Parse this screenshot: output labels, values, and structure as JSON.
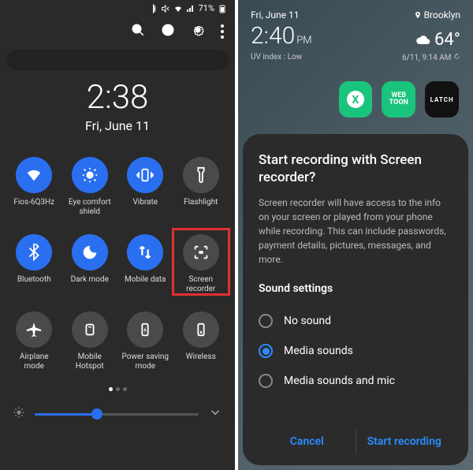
{
  "left": {
    "status": {
      "battery": "71%"
    },
    "clock": {
      "time": "2:38",
      "date": "Fri, June 11"
    },
    "tiles": [
      {
        "label": "Fios-6Q3Hz",
        "icon": "wifi",
        "on": true
      },
      {
        "label": "Eye comfort shield",
        "icon": "eye-comfort",
        "on": true
      },
      {
        "label": "Vibrate",
        "icon": "vibrate",
        "on": true
      },
      {
        "label": "Flashlight",
        "icon": "flashlight",
        "on": false
      },
      {
        "label": "Bluetooth",
        "icon": "bluetooth",
        "on": true
      },
      {
        "label": "Dark mode",
        "icon": "dark-mode",
        "on": true
      },
      {
        "label": "Mobile data",
        "icon": "mobile-data",
        "on": true
      },
      {
        "label": "Screen recorder",
        "icon": "screen-recorder",
        "on": false,
        "highlight": true
      },
      {
        "label": "Airplane mode",
        "icon": "airplane",
        "on": false
      },
      {
        "label": "Mobile Hotspot",
        "icon": "hotspot",
        "on": false
      },
      {
        "label": "Power saving mode",
        "icon": "power-saving",
        "on": false
      },
      {
        "label": "Wireless",
        "icon": "wireless",
        "on": false
      }
    ]
  },
  "right": {
    "top": {
      "date": "Fri, June 11",
      "location": "Brooklyn",
      "time": "2:40",
      "ampm": "PM",
      "temp": "64°",
      "uv": "UV index : Low",
      "updated": "6/11, 9:14 AM"
    },
    "sheet": {
      "title": "Start recording with Screen recorder?",
      "body": "Screen recorder will have access to the info on your screen or played from your phone while recording. This can include passwords, payment details, pictures, messages, and more.",
      "sound_heading": "Sound settings",
      "options": [
        {
          "label": "No sound",
          "checked": false
        },
        {
          "label": "Media sounds",
          "checked": true
        },
        {
          "label": "Media sounds and mic",
          "checked": false
        }
      ],
      "cancel": "Cancel",
      "start": "Start recording"
    }
  }
}
